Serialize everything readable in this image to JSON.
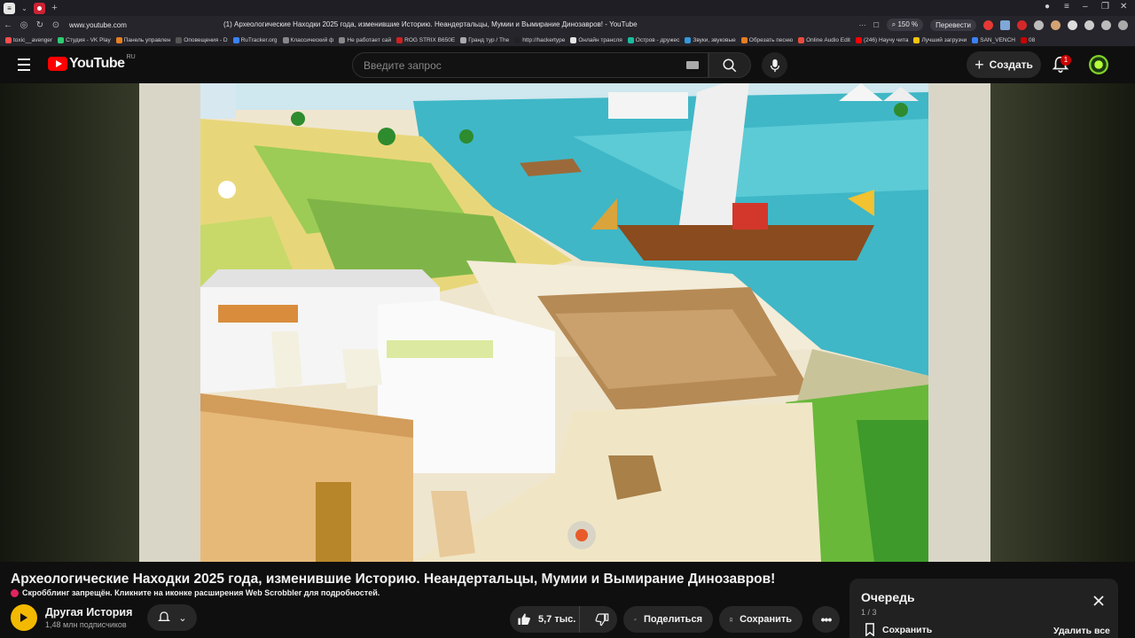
{
  "browser": {
    "url": "www.youtube.com",
    "page_title": "(1) Археологические Находки 2025 года, изменившие Историю. Неандертальцы, Мумии и Вымирание Динозавров! - YouTube",
    "zoom": "150 %",
    "translate_label": "Перевести",
    "bookmarks": [
      {
        "label": "toxic__avenger",
        "color": "#ff4d4d"
      },
      {
        "label": "Студия - VK Play",
        "color": "#2ecc71"
      },
      {
        "label": "Панель управлен",
        "color": "#e67e22"
      },
      {
        "label": "Оповещения - D",
        "color": "#555555"
      },
      {
        "label": "RuTracker.org",
        "color": "#3b82f6"
      },
      {
        "label": "Классический ф",
        "color": "#888888"
      },
      {
        "label": "Не работает сай",
        "color": "#888888"
      },
      {
        "label": "ROG STRIX B650E",
        "color": "#cc2222"
      },
      {
        "label": "Гранд тур / The",
        "color": "#aaaaaa"
      },
      {
        "label": "http://hackertype",
        "color": "#222222"
      },
      {
        "label": "Онлайн трансля",
        "color": "#e5e5e5"
      },
      {
        "label": "Остров - дружес",
        "color": "#1abc9c"
      },
      {
        "label": "Звуки, звуковые",
        "color": "#3498db"
      },
      {
        "label": "Обрезать песню",
        "color": "#e67e22"
      },
      {
        "label": "Online Audio Edit",
        "color": "#e74c3c"
      },
      {
        "label": "(246) Научу чита",
        "color": "#ff0000"
      },
      {
        "label": "Лучший загрузчи",
        "color": "#f1c40f"
      },
      {
        "label": "SAN_VENCH",
        "color": "#3b82f6"
      },
      {
        "label": "08",
        "color": "#cc0000"
      }
    ]
  },
  "header": {
    "logo_text": "YouTube",
    "logo_region": "RU",
    "search_placeholder": "Введите запрос",
    "create_label": "Создать",
    "notification_count": "1"
  },
  "video": {
    "title": "Археологические Находки 2025 года, изменившие Историю. Неандертальцы, Мумии и Вымирание Динозавров!",
    "scrobble_notice": "Скробблинг запрещён. Кликните на иконке расширения Web Scrobbler для подробностей.",
    "channel_name": "Другая История",
    "channel_subscribers": "1,48 млн подписчиков",
    "likes": "5,7 тыс.",
    "share_label": "Поделиться",
    "save_label": "Сохранить"
  },
  "queue": {
    "title": "Очередь",
    "count": "1 / 3",
    "save_label": "Сохранить",
    "delete_all_label": "Удалить все"
  },
  "colors": {
    "brand": "#ff0000",
    "background": "#0f0f0f",
    "button_bg": "#272727"
  }
}
